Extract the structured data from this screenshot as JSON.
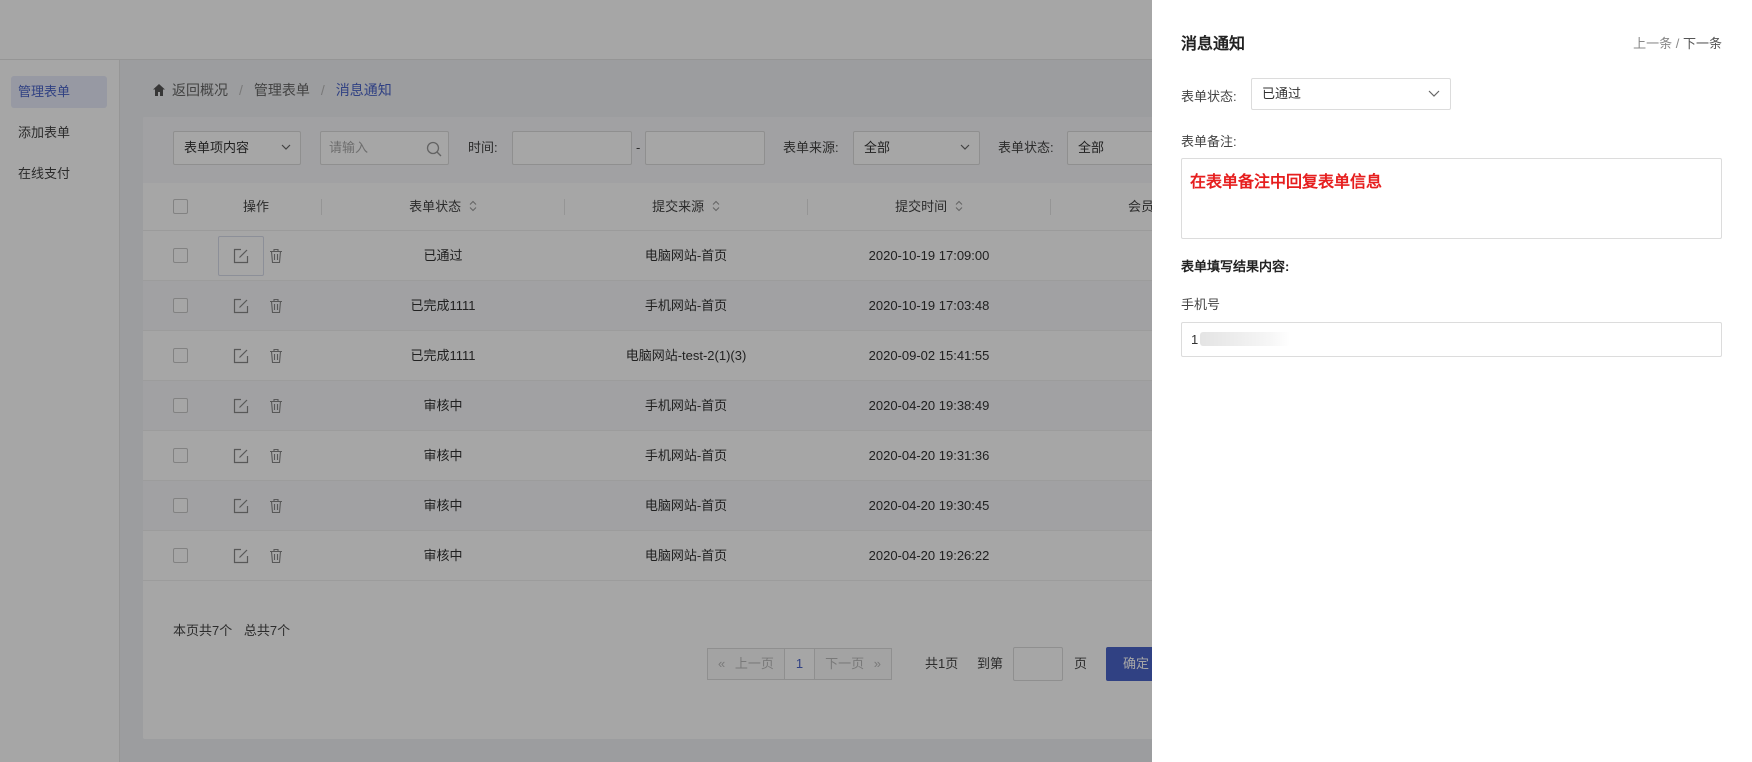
{
  "sidebar": {
    "items": [
      {
        "label": "管理表单",
        "active": true
      },
      {
        "label": "添加表单",
        "active": false
      },
      {
        "label": "在线支付",
        "active": false
      }
    ]
  },
  "breadcrumb": {
    "home": "返回概况",
    "section": "管理表单",
    "current": "消息通知"
  },
  "filters": {
    "item_select": "表单项内容",
    "search_placeholder": "请输入",
    "time_label": "时间:",
    "time_sep": "-",
    "source_label": "表单来源:",
    "source_value": "全部",
    "status_label": "表单状态:",
    "status_value": "全部"
  },
  "table": {
    "columns": [
      "操作",
      "表单状态",
      "提交来源",
      "提交时间",
      "会员"
    ],
    "rows": [
      {
        "status": "已通过",
        "source": "电脑网站-首页",
        "time": "2020-10-19 17:09:00"
      },
      {
        "status": "已完成1111",
        "source": "手机网站-首页",
        "time": "2020-10-19 17:03:48"
      },
      {
        "status": "已完成1111",
        "source": "电脑网站-test-2(1)(3)",
        "time": "2020-09-02 15:41:55"
      },
      {
        "status": "审核中",
        "source": "手机网站-首页",
        "time": "2020-04-20 19:38:49"
      },
      {
        "status": "审核中",
        "source": "手机网站-首页",
        "time": "2020-04-20 19:31:36"
      },
      {
        "status": "审核中",
        "source": "电脑网站-首页",
        "time": "2020-04-20 19:30:45"
      },
      {
        "status": "审核中",
        "source": "电脑网站-首页",
        "time": "2020-04-20 19:26:22"
      }
    ]
  },
  "summary": {
    "page_count": "本页共7个",
    "total_count": "总共7个"
  },
  "pager": {
    "prev": "上一页",
    "current": "1",
    "next": "下一页",
    "total_pages": "共1页",
    "goto_label": "到第",
    "page_unit": "页",
    "confirm": "确定"
  },
  "drawer": {
    "title": "消息通知",
    "nav_prev": "上一条",
    "nav_sep": " / ",
    "nav_next": "下一条",
    "status_label": "表单状态:",
    "status_value": "已通过",
    "remark_label": "表单备注:",
    "remark_value": "在表单备注中回复表单信息",
    "result_label": "表单填写结果内容:",
    "phone_label": "手机号",
    "phone_value": "1"
  },
  "colors": {
    "accent": "#4b64c9",
    "remark_text": "#e61e1e"
  }
}
